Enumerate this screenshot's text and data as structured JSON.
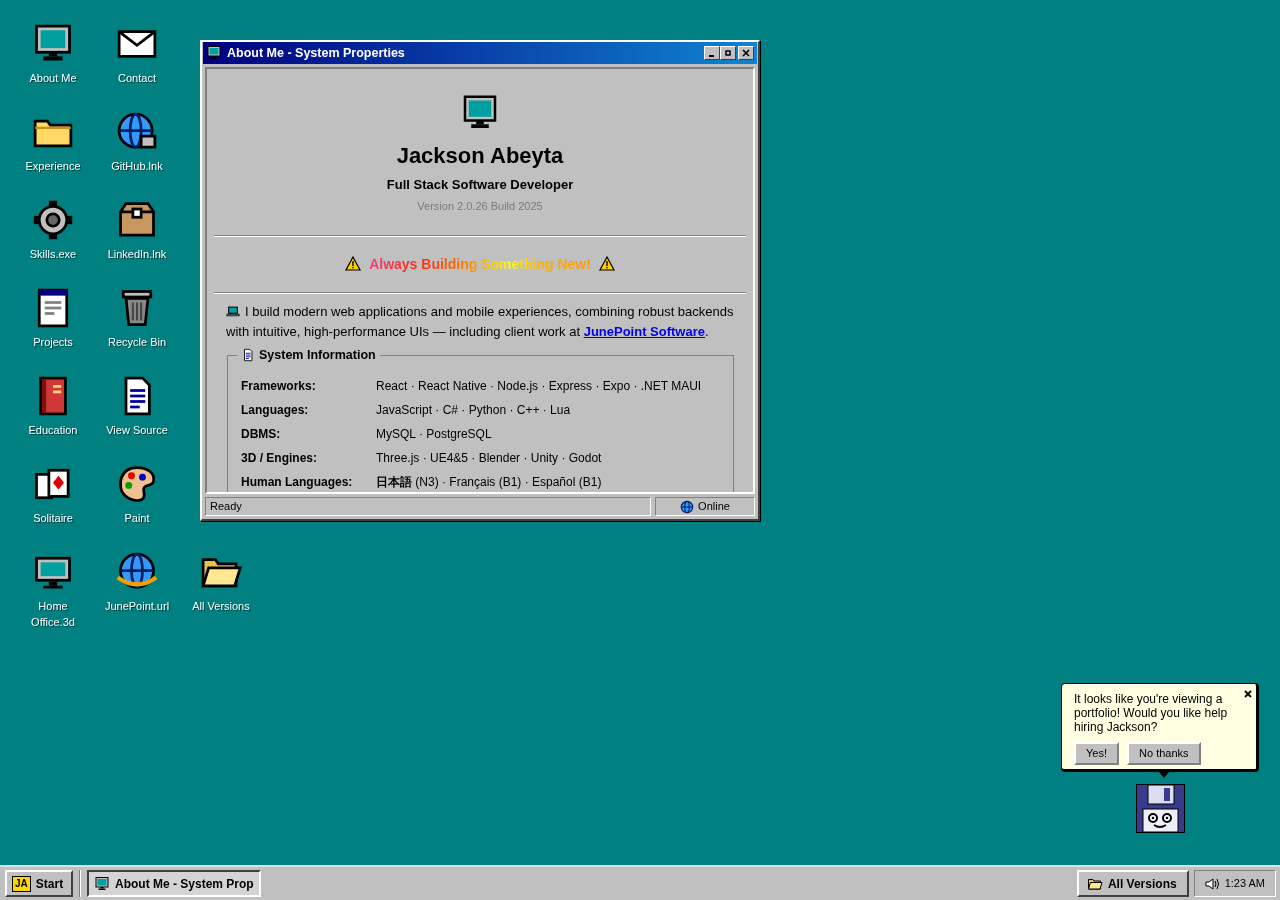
{
  "desktop": {
    "columns": [
      [
        {
          "label": "About Me",
          "kind": "monitor"
        },
        {
          "label": "Experience",
          "kind": "folder"
        },
        {
          "label": "Skills.exe",
          "kind": "gear"
        },
        {
          "label": "Projects",
          "kind": "window-doc"
        },
        {
          "label": "Education",
          "kind": "book"
        },
        {
          "label": "Solitaire",
          "kind": "cards"
        },
        {
          "label": "Home Office.3d",
          "kind": "monitor-gray"
        }
      ],
      [
        {
          "label": "Contact",
          "kind": "envelope"
        },
        {
          "label": "GitHub.lnk",
          "kind": "globe-lock"
        },
        {
          "label": "LinkedIn.lnk",
          "kind": "box"
        },
        {
          "label": "Recycle Bin",
          "kind": "trash"
        },
        {
          "label": "View Source",
          "kind": "text-doc"
        },
        {
          "label": "Paint",
          "kind": "palette"
        },
        {
          "label": "JunePoint.url",
          "kind": "globe-swoosh"
        }
      ],
      [
        {
          "label": "All Versions",
          "kind": "open-folder"
        }
      ]
    ]
  },
  "window": {
    "title": "About Me - System Properties",
    "profile": {
      "name": "Jackson Abeyta",
      "role": "Full Stack Software Developer",
      "version": "Version 2.0.26 Build 2025"
    },
    "tagline": "Always Building Something New!",
    "intro": {
      "text": "I build modern web applications and mobile experiences, combining robust backends with intuitive, high-performance UIs — including client work at ",
      "link": "JunePoint Software",
      "after": "."
    },
    "system_info": {
      "title": "System Information",
      "rows": [
        {
          "label": "Frameworks:",
          "value": "React · React Native · Node.js · Express · Expo · .NET MAUI"
        },
        {
          "label": "Languages:",
          "value": "JavaScript · C# · Python · C++ · Lua"
        },
        {
          "label": "DBMS:",
          "value": "MySQL · PostgreSQL"
        },
        {
          "label": "3D / Engines:",
          "value": "Three.js · UE4&5 · Blender · Unity · Godot"
        },
        {
          "label": "Human Languages:",
          "value": "**日本語** (N3) · Français (B1) · Español (B1)"
        }
      ]
    },
    "status_bar": {
      "left": "Ready",
      "right": "Online"
    }
  },
  "assistant": {
    "message": "It looks like you're viewing a portfolio! Would you like help hiring Jackson?",
    "buttons": [
      "Yes!",
      "No thanks"
    ]
  },
  "taskbar": {
    "logo": "JA",
    "start": "Start",
    "tasks": [
      {
        "label": "About Me - System Prop",
        "selected": true
      }
    ],
    "quick_launch": "All Versions",
    "clock": "1:23 AM"
  }
}
